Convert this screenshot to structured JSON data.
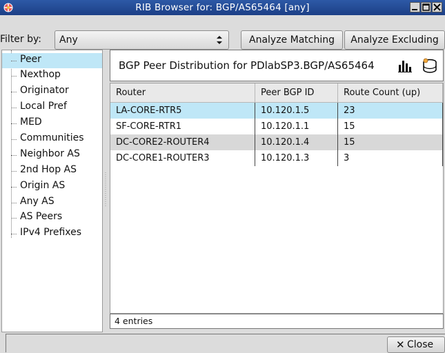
{
  "window": {
    "title": "RIB Browser for: BGP/AS65464 [any]"
  },
  "filter": {
    "label": "Filter by:",
    "value": "Any"
  },
  "buttons": {
    "analyze_matching": "Analyze Matching",
    "analyze_excluding": "Analyze Excluding",
    "close": "Close"
  },
  "tree": {
    "items": [
      "Peer",
      "Nexthop",
      "Originator",
      "Local Pref",
      "MED",
      "Communities",
      "Neighbor AS",
      "2nd Hop AS",
      "Origin AS",
      "Any AS",
      "AS Peers",
      "IPv4 Prefixes"
    ],
    "selected": "Peer"
  },
  "panel": {
    "heading": "BGP Peer Distribution for PDlabSP3.BGP/AS65464",
    "icons": [
      "bar-chart-icon",
      "database-icon"
    ],
    "columns": [
      "Router",
      "Peer BGP ID",
      "Route Count (up)"
    ],
    "rows": [
      {
        "router": "LA-CORE-RTR5",
        "peer_bgp_id": "10.120.1.5",
        "route_count": "23"
      },
      {
        "router": "SF-CORE-RTR1",
        "peer_bgp_id": "10.120.1.1",
        "route_count": "15"
      },
      {
        "router": "DC-CORE2-ROUTER4",
        "peer_bgp_id": "10.120.1.4",
        "route_count": "15"
      },
      {
        "router": "DC-CORE1-ROUTER3",
        "peer_bgp_id": "10.120.1.3",
        "route_count": "3"
      }
    ],
    "status": "4 entries"
  },
  "colors": {
    "titlebar": "#1c3f86",
    "selection": "#bfe7f7"
  }
}
